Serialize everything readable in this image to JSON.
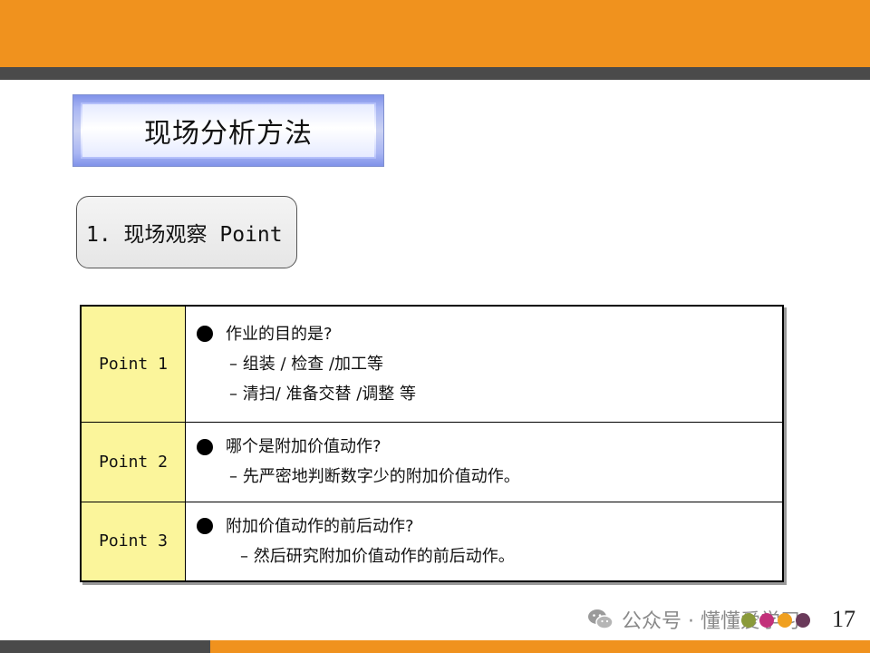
{
  "colors": {
    "accent": "#f0921e",
    "stripe": "#4a4a4a",
    "label_fill": "#fbf59b"
  },
  "title": "现场分析方法",
  "subtitle": "1. 现场观察 Point",
  "points": [
    {
      "label": "Point 1",
      "question": "作业的目的是?",
      "details": [
        "– 组装 / 检查 /加工等",
        "– 清扫/ 准备交替 /调整 等"
      ]
    },
    {
      "label": "Point 2",
      "question": "哪个是附加价值动作?",
      "details": [
        "– 先严密地判断数字少的附加价值动作。"
      ]
    },
    {
      "label": "Point 3",
      "question": "附加价值动作的前后动作?",
      "details": [
        "– 然后研究附加价值动作的前后动作。"
      ]
    }
  ],
  "watermark": {
    "icon": "wechat-icon",
    "text": "公众号 · 懂懂爱学习"
  },
  "page_number": "17"
}
